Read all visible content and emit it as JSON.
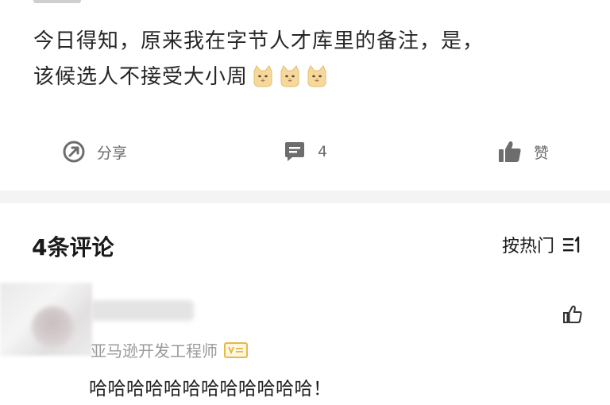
{
  "post": {
    "text_line1": "今日得知，原来我在字节人才库里的备注，是，",
    "text_line2": "该候选人不接受大小周",
    "emojis": [
      "cat-face-emoji",
      "cat-face-emoji",
      "cat-face-emoji"
    ]
  },
  "actions": {
    "share_label": "分享",
    "comment_count": "4",
    "like_label": "赞"
  },
  "comments_section": {
    "count_label": "4条评论",
    "sort_label": "按热门"
  },
  "comment": {
    "job_title": "亚马逊开发工程师",
    "text": "哈哈哈哈哈哈哈哈哈哈哈哈！"
  },
  "colors": {
    "text_primary": "#262626",
    "text_secondary": "#6d6d6d",
    "text_muted": "#9a9a9a",
    "divider": "#f4f4f4",
    "badge": "#e6b84a"
  }
}
